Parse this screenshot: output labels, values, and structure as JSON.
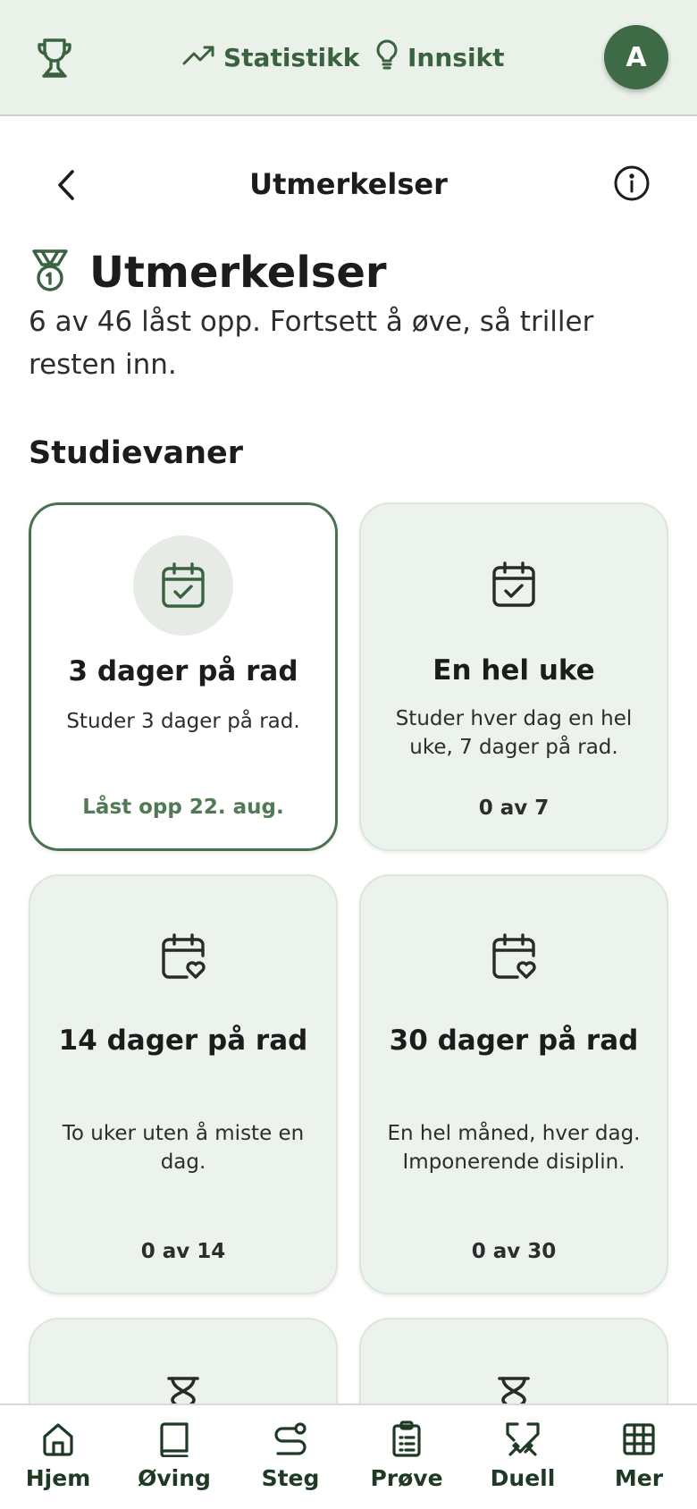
{
  "topbar": {
    "stats_label": "Statistikk",
    "insight_label": "Innsikt",
    "avatar_initial": "A",
    "accent_color": "#3b6240"
  },
  "page": {
    "title": "Utmerkelser",
    "heading": "Utmerkelser",
    "subtitle": "6 av 46 låst opp. Fortsett å øve, så triller resten inn."
  },
  "section": {
    "title": "Studievaner"
  },
  "cards": [
    {
      "icon": "calendar-check-icon",
      "title": "3 dager på rad",
      "desc": "Studer 3 dager på rad.",
      "status": "Låst opp 22. aug.",
      "unlocked": true
    },
    {
      "icon": "calendar-check-icon",
      "title": "En hel uke",
      "desc": "Studer hver dag en hel uke, 7 dager på rad.",
      "status": "0 av 7",
      "unlocked": false
    },
    {
      "icon": "calendar-heart-icon",
      "title": "14 dager på rad",
      "desc": "To uker uten å miste en dag.",
      "status": "0 av 14",
      "unlocked": false
    },
    {
      "icon": "calendar-heart-icon",
      "title": "30 dager på rad",
      "desc": "En hel måned, hver dag. Imponerende disiplin.",
      "status": "0 av 30",
      "unlocked": false
    },
    {
      "icon": "hourglass-icon",
      "unlocked": false
    },
    {
      "icon": "hourglass-icon",
      "unlocked": false
    }
  ],
  "bottomnav": [
    {
      "icon": "home-icon",
      "label": "Hjem"
    },
    {
      "icon": "book-icon",
      "label": "Øving"
    },
    {
      "icon": "route-icon",
      "label": "Steg"
    },
    {
      "icon": "clipboard-icon",
      "label": "Prøve"
    },
    {
      "icon": "swords-icon",
      "label": "Duell"
    },
    {
      "icon": "grid-icon",
      "label": "Mer"
    }
  ]
}
